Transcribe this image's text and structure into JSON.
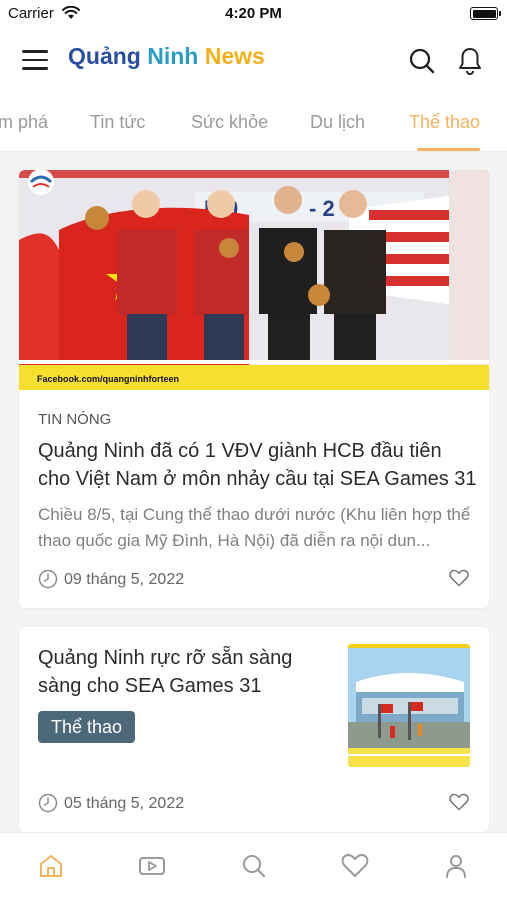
{
  "status_bar": {
    "carrier": "Carrier",
    "time": "4:20 PM"
  },
  "header": {
    "title_part_1": "Quảng",
    "title_part_2": " Ninh",
    "title_part_3": " News",
    "menu_icon": "hamburger-menu-icon",
    "search_icon": "search-icon",
    "notification_icon": "bell-icon"
  },
  "tabs": [
    {
      "label": "m phá",
      "active": false
    },
    {
      "label": "Tin tức",
      "active": false
    },
    {
      "label": "Sức khỏe",
      "active": false
    },
    {
      "label": "Du lịch",
      "active": false
    },
    {
      "label": "Thể thao",
      "active": true
    }
  ],
  "featured_article": {
    "tag": "TIN NÓNG",
    "title": "Quảng Ninh đã có 1 VĐV giành HCB đầu tiên cho Việt Nam ở môn nhảy cầu tại SEA Games 31",
    "excerpt": "Chiều 8/5, tại Cung thể thao dưới nước (Khu liên hợp thể thao quốc gia Mỹ Đình, Hà Nội) đã diễn ra nội dun...",
    "date": "09 tháng 5, 2022",
    "image_caption": "Facebook.com/quangninhforteen"
  },
  "second_article": {
    "title": "Quảng Ninh rực rỡ sẵn sàng sàng cho SEA Games 31",
    "category": "Thể thao",
    "date": "05 tháng 5, 2022"
  },
  "bottom_nav": [
    {
      "icon": "home-icon",
      "active": true
    },
    {
      "icon": "video-icon",
      "active": false
    },
    {
      "icon": "search-icon",
      "active": false
    },
    {
      "icon": "heart-icon",
      "active": false
    },
    {
      "icon": "profile-icon",
      "active": false
    }
  ],
  "colors": {
    "accent": "#f4b35f",
    "title_blue": "#2b4fa0",
    "title_teal": "#2c9cc4",
    "title_yellow": "#f2b11a",
    "chip": "#4d6878"
  }
}
